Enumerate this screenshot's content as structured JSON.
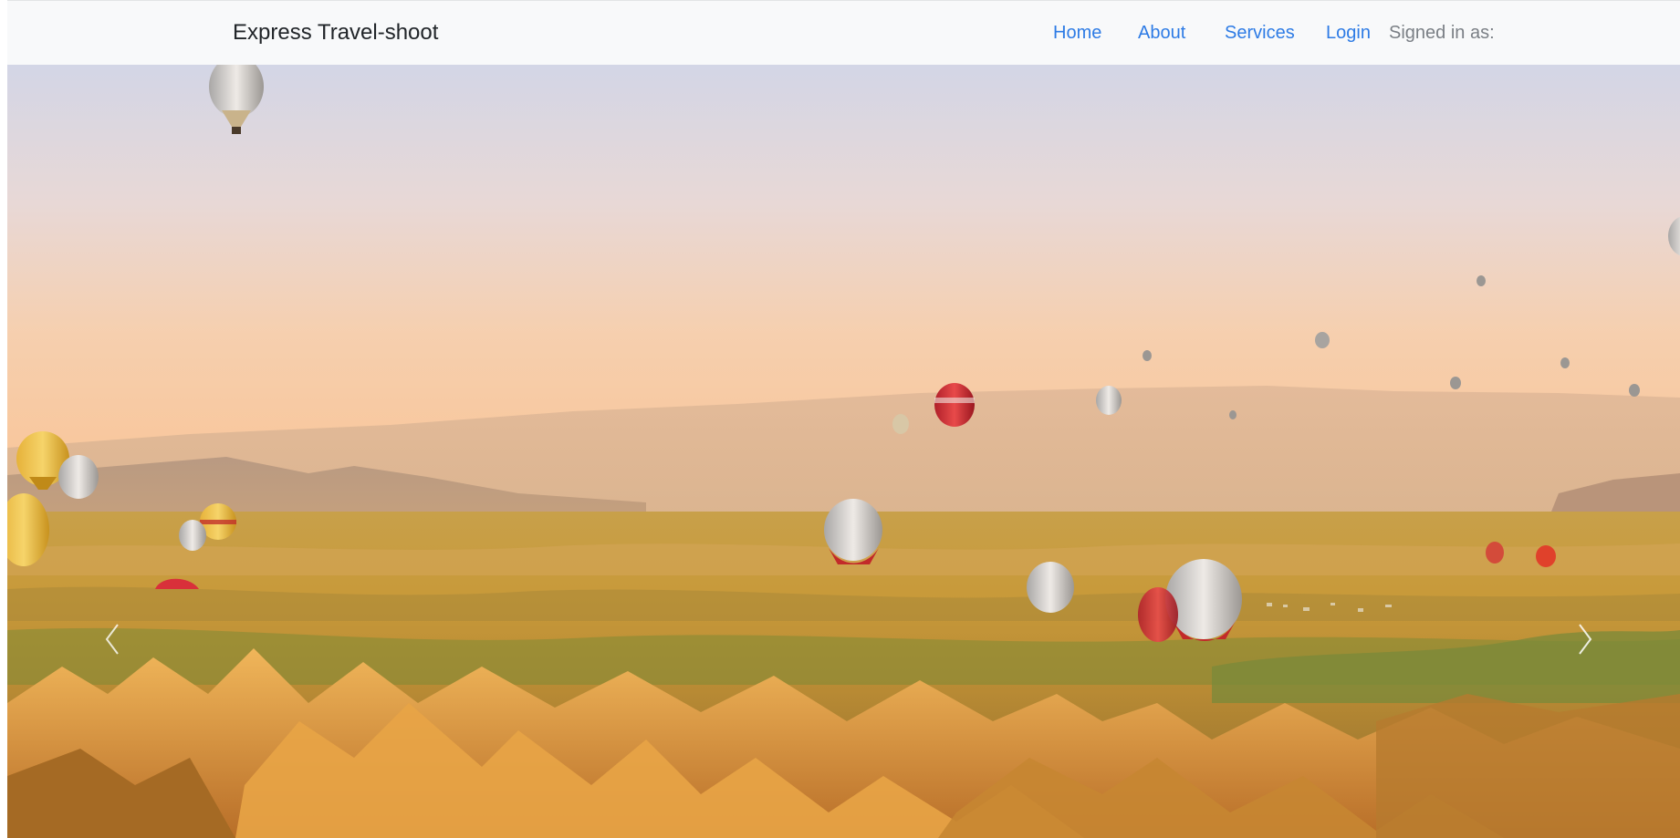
{
  "navbar": {
    "brand": "Express Travel-shoot",
    "items": [
      {
        "label": "Home"
      },
      {
        "label": "About"
      },
      {
        "label": "Services"
      },
      {
        "label": "Login"
      }
    ],
    "signed_in_label": "Signed in as:"
  },
  "hero": {
    "image_subject": "hot-air-balloons-over-valley",
    "prev_icon": "chevron-left-icon",
    "next_icon": "chevron-right-icon"
  },
  "colors": {
    "navbar_bg": "#f8f9fa",
    "link": "#2d7be5",
    "muted_text": "#7a7f85",
    "brand_text": "#212529"
  }
}
